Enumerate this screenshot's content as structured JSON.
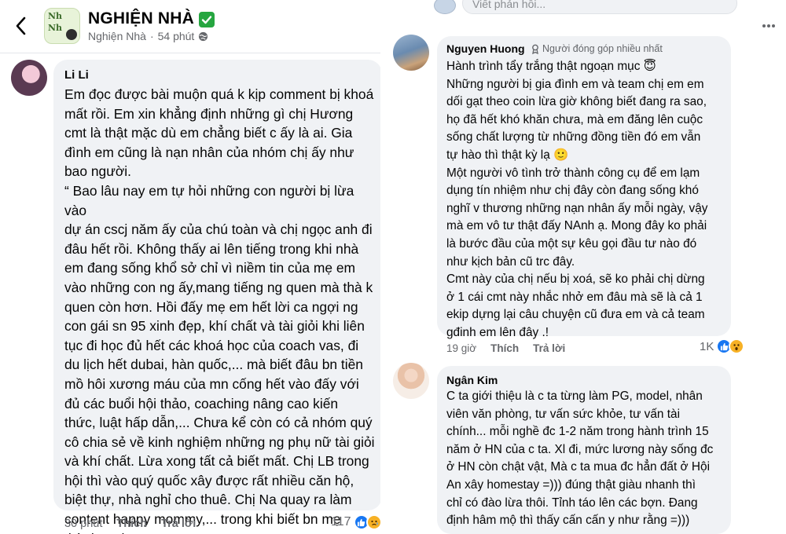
{
  "post": {
    "page_name": "NGHIỆN NHÀ",
    "page_name_sub": "Nghiện Nhà",
    "time": "54 phút",
    "separator": "·"
  },
  "icons": {
    "back": "chevron-left-icon",
    "verified": "green-check-icon",
    "globe": "globe-icon",
    "more": "more-dots-icon",
    "contributor": "top-contributor-icon"
  },
  "reply_input": {
    "placeholder": "Viết phản hồi..."
  },
  "comments": [
    {
      "author": "Li Li",
      "text": "Em đọc được bài muộn quá k kịp comment bị khoá\nmất rồi. Em xin khẳng định những gì chị Hương\ncmt là thật mặc dù em chẳng biết c ấy là ai. Gia\nđình em cũng là nạn nhân của nhóm chị ấy như\nbao người.\n“ Bao lâu nay em tự hỏi những con người bị lừa vào\ndự án cscj năm ấy của chú toàn và chị ngọc anh đi\nđâu hết rồi. Không thấy ai lên tiếng trong khi nhà\nem đang sống khổ sở chỉ vì niềm tin của mẹ em\nvào những con ng ấy,mang tiếng ng quen mà thà k\nquen còn hơn. Hồi đấy mẹ em hết lời ca ngợi ng\ncon gái sn 95 xinh đẹp, khí chất và tài giỏi khi liên\ntục đi học đủ hết các khoá học của coach vas, đi\ndu lịch hết dubai, hàn quốc,... mà biết đâu bn tiền\nmồ hôi xương máu của mn cống hết vào đấy với\nđủ các buổi hội thảo, coaching nâng cao kiến\nthức, luật hấp dẫn,... Chưa kể còn có cả nhóm quý\ncô chia sẻ về kinh nghiệm những ng phụ nữ tài giỏi\nvà khí chất. Lừa xong tất cả biết mất. Chị LB trong\nhội thì vào quý quốc xây được rất nhiều căn hộ,\nbiệt thự, nhà nghỉ cho thuê. Chị Na quay ra làm\ncontent happy mommy,... trong khi biết bn mẹ\nthành sad mommy”",
      "time": "30 phút",
      "like_label": "Thích",
      "reply_label": "Trả lời",
      "reaction_count": "117",
      "reactions": [
        "like",
        "sad"
      ]
    },
    {
      "author": "Nguyen Huong",
      "badge": "Người đóng góp nhiều nhất",
      "text": "Hành trình tẩy trắng thật ngoạn mục 😇\nNhững người bị gia đình em và team chị em em\ndối gạt theo coin lừa giờ không biết đang ra sao,\nhọ đã hết khó khăn chưa, mà em đăng lên cuộc\nsống chất lượng từ những đồng tiền đó em vẫn\ntự hào thì thật kỳ lạ 🙂\nMột người vô tình trở thành công cụ để em lạm\ndụng tín nhiệm như chị đây còn đang sống khó\nnghĩ v thương những nạn nhân ấy mỗi ngày, vậy\nmà em vô tư thật đấy NAnh ạ. Mong đây ko phải\nlà bước đầu của một sự kêu gọi đầu tư nào đó\nnhư kịch bản cũ trc đây.\nCmt này của chị nếu bị xoá, sẽ ko phải chị dừng\nở 1 cái cmt này nhắc nhở em đâu mà sẽ là cả 1\nekip dựng lại câu chuyện cũ đưa em và cả team\ngđinh em lên đây .!",
      "time": "19 giờ",
      "like_label": "Thích",
      "reply_label": "Trả lời",
      "reaction_count": "1K",
      "reactions": [
        "like",
        "wow"
      ]
    },
    {
      "author": "Ngân Kim",
      "text": "C ta giới thiệu là c ta từng làm PG, model, nhân\nviên văn phòng, tư vấn sức khỏe, tư vấn tài\nchính... mỗi nghề đc 1-2 năm trong hành trình 15\nnăm ở HN của c ta. Xl đi, mức lương này sống đc\nở HN còn chật vật, Mà c ta mua đc hẳn đất ở Hội\nAn xây homestay =))) đúng thật giàu nhanh thì\nchỉ có đào lừa thôi. Tỉnh táo lên các bợn. Đang\nđịnh hâm mộ thì thấy cấn cấn y như rằng =)))"
    }
  ],
  "colors": {
    "bubble": "#f0f2f5",
    "muted_text": "#65676b",
    "like_blue": "#1877f2",
    "emoji_yellow": "#f7b125",
    "verified_green": "#26a640"
  }
}
